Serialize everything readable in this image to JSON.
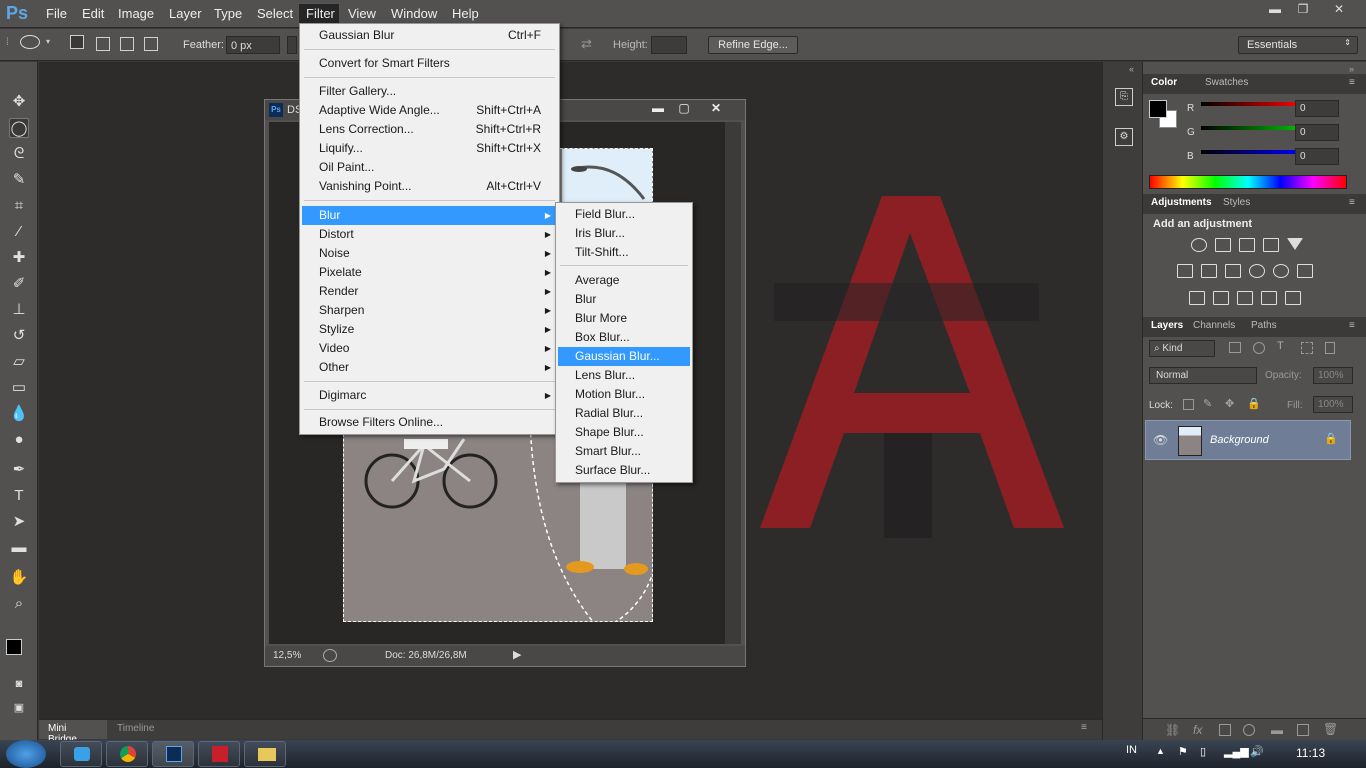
{
  "app": {
    "logo": "Ps"
  },
  "menubar": [
    "File",
    "Edit",
    "Image",
    "Layer",
    "Type",
    "Select",
    "Filter",
    "View",
    "Window",
    "Help"
  ],
  "window_controls": {
    "minimize": "▬",
    "restore": "❐",
    "close": "✕"
  },
  "options_bar": {
    "feather_label": "Feather:",
    "feather_value": "0 px",
    "height_label": "Height:",
    "refine_edge": "Refine Edge...",
    "workspace": "Essentials"
  },
  "document": {
    "title": "DS",
    "zoom": "12,5%",
    "doc_size": "Doc: 26,8M/26,8M"
  },
  "filter_menu": {
    "items": [
      {
        "label": "Gaussian Blur",
        "shortcut": "Ctrl+F"
      },
      {
        "label": "Convert for Smart Filters",
        "shortcut": ""
      },
      {
        "label": "Filter Gallery...",
        "shortcut": ""
      },
      {
        "label": "Adaptive Wide Angle...",
        "shortcut": "Shift+Ctrl+A"
      },
      {
        "label": "Lens Correction...",
        "shortcut": "Shift+Ctrl+R"
      },
      {
        "label": "Liquify...",
        "shortcut": "Shift+Ctrl+X"
      },
      {
        "label": "Oil Paint...",
        "shortcut": ""
      },
      {
        "label": "Vanishing Point...",
        "shortcut": "Alt+Ctrl+V"
      },
      {
        "label": "Blur",
        "shortcut": ""
      },
      {
        "label": "Distort",
        "shortcut": ""
      },
      {
        "label": "Noise",
        "shortcut": ""
      },
      {
        "label": "Pixelate",
        "shortcut": ""
      },
      {
        "label": "Render",
        "shortcut": ""
      },
      {
        "label": "Sharpen",
        "shortcut": ""
      },
      {
        "label": "Stylize",
        "shortcut": ""
      },
      {
        "label": "Video",
        "shortcut": ""
      },
      {
        "label": "Other",
        "shortcut": ""
      },
      {
        "label": "Digimarc",
        "shortcut": ""
      },
      {
        "label": "Browse Filters Online...",
        "shortcut": ""
      }
    ]
  },
  "blur_submenu": {
    "items": [
      "Field Blur...",
      "Iris Blur...",
      "Tilt-Shift...",
      "Average",
      "Blur",
      "Blur More",
      "Box Blur...",
      "Gaussian Blur...",
      "Lens Blur...",
      "Motion Blur...",
      "Radial Blur...",
      "Shape Blur...",
      "Smart Blur...",
      "Surface Blur..."
    ]
  },
  "color_panel": {
    "tabs": [
      "Color",
      "Swatches"
    ],
    "channels": [
      {
        "label": "R",
        "value": "0"
      },
      {
        "label": "G",
        "value": "0"
      },
      {
        "label": "B",
        "value": "0"
      }
    ],
    "colors": {
      "r": "#ff0000",
      "g": "#00c000",
      "b": "#0000ff"
    }
  },
  "adjustments_panel": {
    "tabs": [
      "Adjustments",
      "Styles"
    ],
    "heading": "Add an adjustment"
  },
  "layers_panel": {
    "tabs": [
      "Layers",
      "Channels",
      "Paths"
    ],
    "kind": "Kind",
    "blend_mode": "Normal",
    "opacity_label": "Opacity:",
    "opacity_value": "100%",
    "lock_label": "Lock:",
    "fill_label": "Fill:",
    "fill_value": "100%",
    "layer_name": "Background"
  },
  "bottom_tabs": [
    "Mini Bridge",
    "Timeline"
  ],
  "taskbar": {
    "lang": "IN",
    "time": "11:13"
  },
  "accent_color": "#3399ff",
  "logo_a_color": "#8b1f24"
}
